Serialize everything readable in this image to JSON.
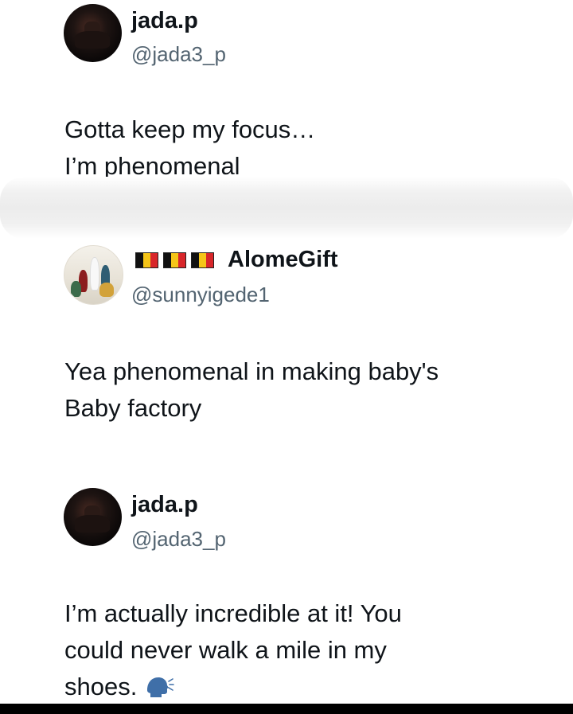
{
  "tweets": [
    {
      "name": "jada.p",
      "handle": "@jada3_p",
      "lines": [
        "Gotta keep my focus…",
        "I’m phenomenal"
      ]
    },
    {
      "name_prefix_icons": [
        "belgium-flag-icon",
        "belgium-flag-icon",
        "belgium-flag-icon"
      ],
      "name": "AlomeGift",
      "handle": "@sunnyigede1",
      "lines": [
        "Yea phenomenal in making baby's",
        "Baby factory"
      ]
    },
    {
      "name": "jada.p",
      "handle": "@jada3_p",
      "lines": [
        "I’m actually incredible at it! You",
        "could never walk a mile in my",
        "shoes."
      ],
      "trailing_icon": "speaking-head-icon"
    }
  ],
  "colors": {
    "text_primary": "#0f1419",
    "text_secondary": "#536471",
    "background": "#ffffff"
  }
}
